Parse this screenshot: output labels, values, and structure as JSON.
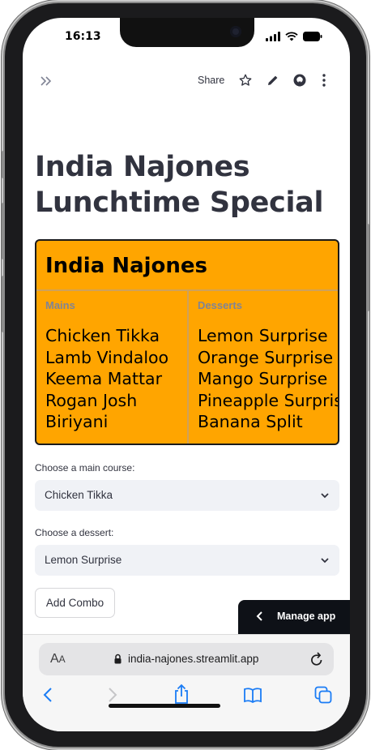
{
  "status": {
    "time": "16:13"
  },
  "header": {
    "share_label": "Share"
  },
  "page": {
    "title": "India Najones Lunchtime Special"
  },
  "menu": {
    "heading": "India Najones",
    "mains_label": "Mains",
    "desserts_label": "Desserts",
    "mains": [
      "Chicken Tikka",
      "Lamb Vindaloo",
      "Keema Mattar",
      "Rogan Josh",
      "Biriyani"
    ],
    "desserts": [
      "Lemon Surprise",
      "Orange Surprise",
      "Mango Surprise",
      "Pineapple Surprise",
      "Banana Split"
    ],
    "background_color": "#ffa500"
  },
  "form": {
    "main_label": "Choose a main course:",
    "main_value": "Chicken Tikka",
    "dessert_label": "Choose a dessert:",
    "dessert_value": "Lemon Surprise",
    "add_button": "Add Combo"
  },
  "manage_app": {
    "label": "Manage app"
  },
  "browser": {
    "aa_big": "A",
    "aa_small": "A",
    "url": "india-najones.streamlit.app"
  },
  "icons": {
    "expand": "double-chevron-right-icon",
    "star": "star-icon",
    "edit": "pencil-icon",
    "github": "github-icon",
    "more": "vertical-dots-icon"
  }
}
